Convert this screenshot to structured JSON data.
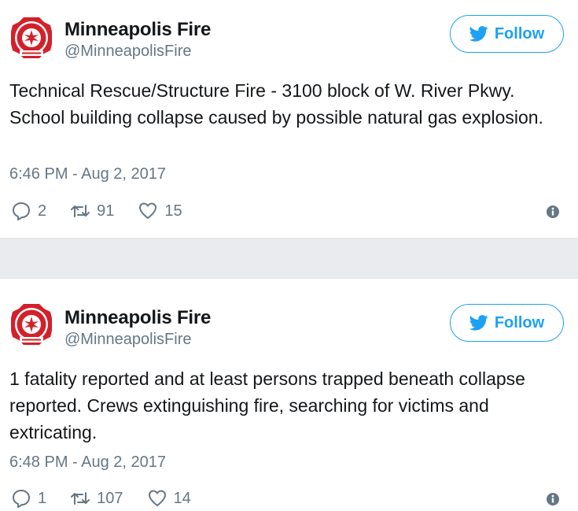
{
  "colors": {
    "accent": "#1da1f2",
    "secondary_text": "#657786",
    "separator": "#e9ebee",
    "badge_red": "#d4202a"
  },
  "tweets": [
    {
      "author_name": "Minneapolis Fire",
      "author_handle": "@MinneapolisFire",
      "follow_label": "Follow",
      "text": "Technical Rescue/Structure Fire - 3100 block of W. River Pkwy. School building collapse caused by possible natural gas explosion.",
      "timestamp": "6:46 PM - Aug 2, 2017",
      "replies": "2",
      "retweets": "91",
      "likes": "15",
      "icons": {
        "avatar": "fire-department-badge-icon",
        "follow": "twitter-bird-icon",
        "reply": "reply-icon",
        "retweet": "retweet-icon",
        "like": "heart-icon",
        "info": "info-icon"
      }
    },
    {
      "author_name": "Minneapolis Fire",
      "author_handle": "@MinneapolisFire",
      "follow_label": "Follow",
      "text": "1 fatality reported and at least persons trapped beneath collapse reported. Crews extinguishing fire, searching for victims and extricating.",
      "timestamp": "6:48 PM - Aug 2, 2017",
      "replies": "1",
      "retweets": "107",
      "likes": "14",
      "icons": {
        "avatar": "fire-department-badge-icon",
        "follow": "twitter-bird-icon",
        "reply": "reply-icon",
        "retweet": "retweet-icon",
        "like": "heart-icon",
        "info": "info-icon"
      }
    }
  ]
}
